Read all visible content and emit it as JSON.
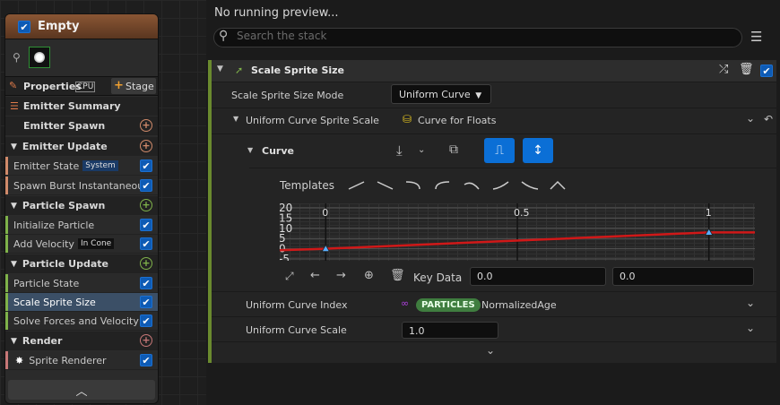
{
  "emitter": {
    "title": "Empty",
    "tabs": {
      "properties": "Properties",
      "cpu": "CPU",
      "stage": "Stage"
    },
    "sections": [
      {
        "label": "Emitter Summary"
      },
      {
        "label": "Emitter Spawn"
      },
      {
        "label": "Emitter Update"
      },
      {
        "label": "Particle Spawn"
      },
      {
        "label": "Particle Update"
      },
      {
        "label": "Render"
      }
    ],
    "items": {
      "emitter_state": "Emitter State",
      "emitter_state_tag": "System",
      "spawn_burst": "Spawn Burst Instantaneous",
      "initialize_particle": "Initialize Particle",
      "add_velocity": "Add Velocity",
      "add_velocity_tag": "In Cone",
      "particle_state": "Particle State",
      "scale_sprite_size": "Scale Sprite Size",
      "solve_forces": "Solve Forces and Velocity",
      "sprite_renderer": "Sprite Renderer"
    },
    "colors": {
      "update": "#d08a6a",
      "spawn": "#7fb24a",
      "render": "#c77777"
    }
  },
  "preview": {
    "text": "No running preview..."
  },
  "search": {
    "placeholder": "Search the stack"
  },
  "module": {
    "title": "Scale Sprite Size",
    "mode_label": "Scale Sprite Size Mode",
    "mode_value": "Uniform Curve",
    "curve_scale_label": "Uniform Curve Sprite Scale",
    "curve_asset": "Curve for Floats",
    "curve_label": "Curve",
    "templates_label": "Templates",
    "key_data_label": "Key Data",
    "key_time": "0.0",
    "key_value": "0.0",
    "index_label": "Uniform Curve Index",
    "index_badge": "PARTICLES",
    "index_value": "NormalizedAge",
    "scale_label": "Uniform Curve Scale",
    "scale_value": "1.0"
  },
  "chart_data": {
    "type": "line",
    "title": "",
    "xlabel": "",
    "ylabel": "",
    "x_ticks": [
      "0",
      "0.5",
      "1"
    ],
    "y_ticks": [
      "20",
      "15",
      "10",
      "5",
      "0",
      "-5"
    ],
    "xlim": [
      -0.12,
      1.12
    ],
    "ylim": [
      -5,
      20
    ],
    "series": [
      {
        "x": [
          -0.12,
          0,
          1,
          1.12
        ],
        "y": [
          -0.7,
          0,
          8,
          8
        ]
      }
    ],
    "keys": [
      {
        "x": 0,
        "y": 0
      },
      {
        "x": 1,
        "y": 8
      }
    ]
  }
}
